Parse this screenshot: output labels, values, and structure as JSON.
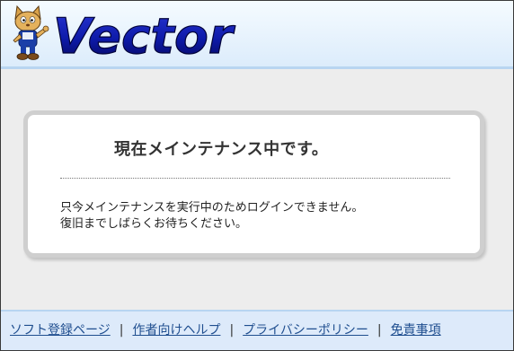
{
  "header": {
    "logo_text": "Vector",
    "mascot_icon": "cat-mascot-icon",
    "colors": {
      "logo_blue": "#0d1aa8",
      "logo_dark": "#05065a",
      "header_top": "#f5fbff",
      "header_bottom": "#dcecfb"
    }
  },
  "notice": {
    "title": "現在メインテナンス中です。",
    "message_line1": "只今メインテナンスを実行中のためログインできません。",
    "message_line2": "復旧までしばらくお待ちください。"
  },
  "footer": {
    "links": [
      {
        "label": "ソフト登録ページ"
      },
      {
        "label": "作者向けヘルプ"
      },
      {
        "label": "プライバシーポリシー"
      },
      {
        "label": "免責事項"
      }
    ],
    "separator": "|",
    "link_color": "#1f4e8f"
  }
}
